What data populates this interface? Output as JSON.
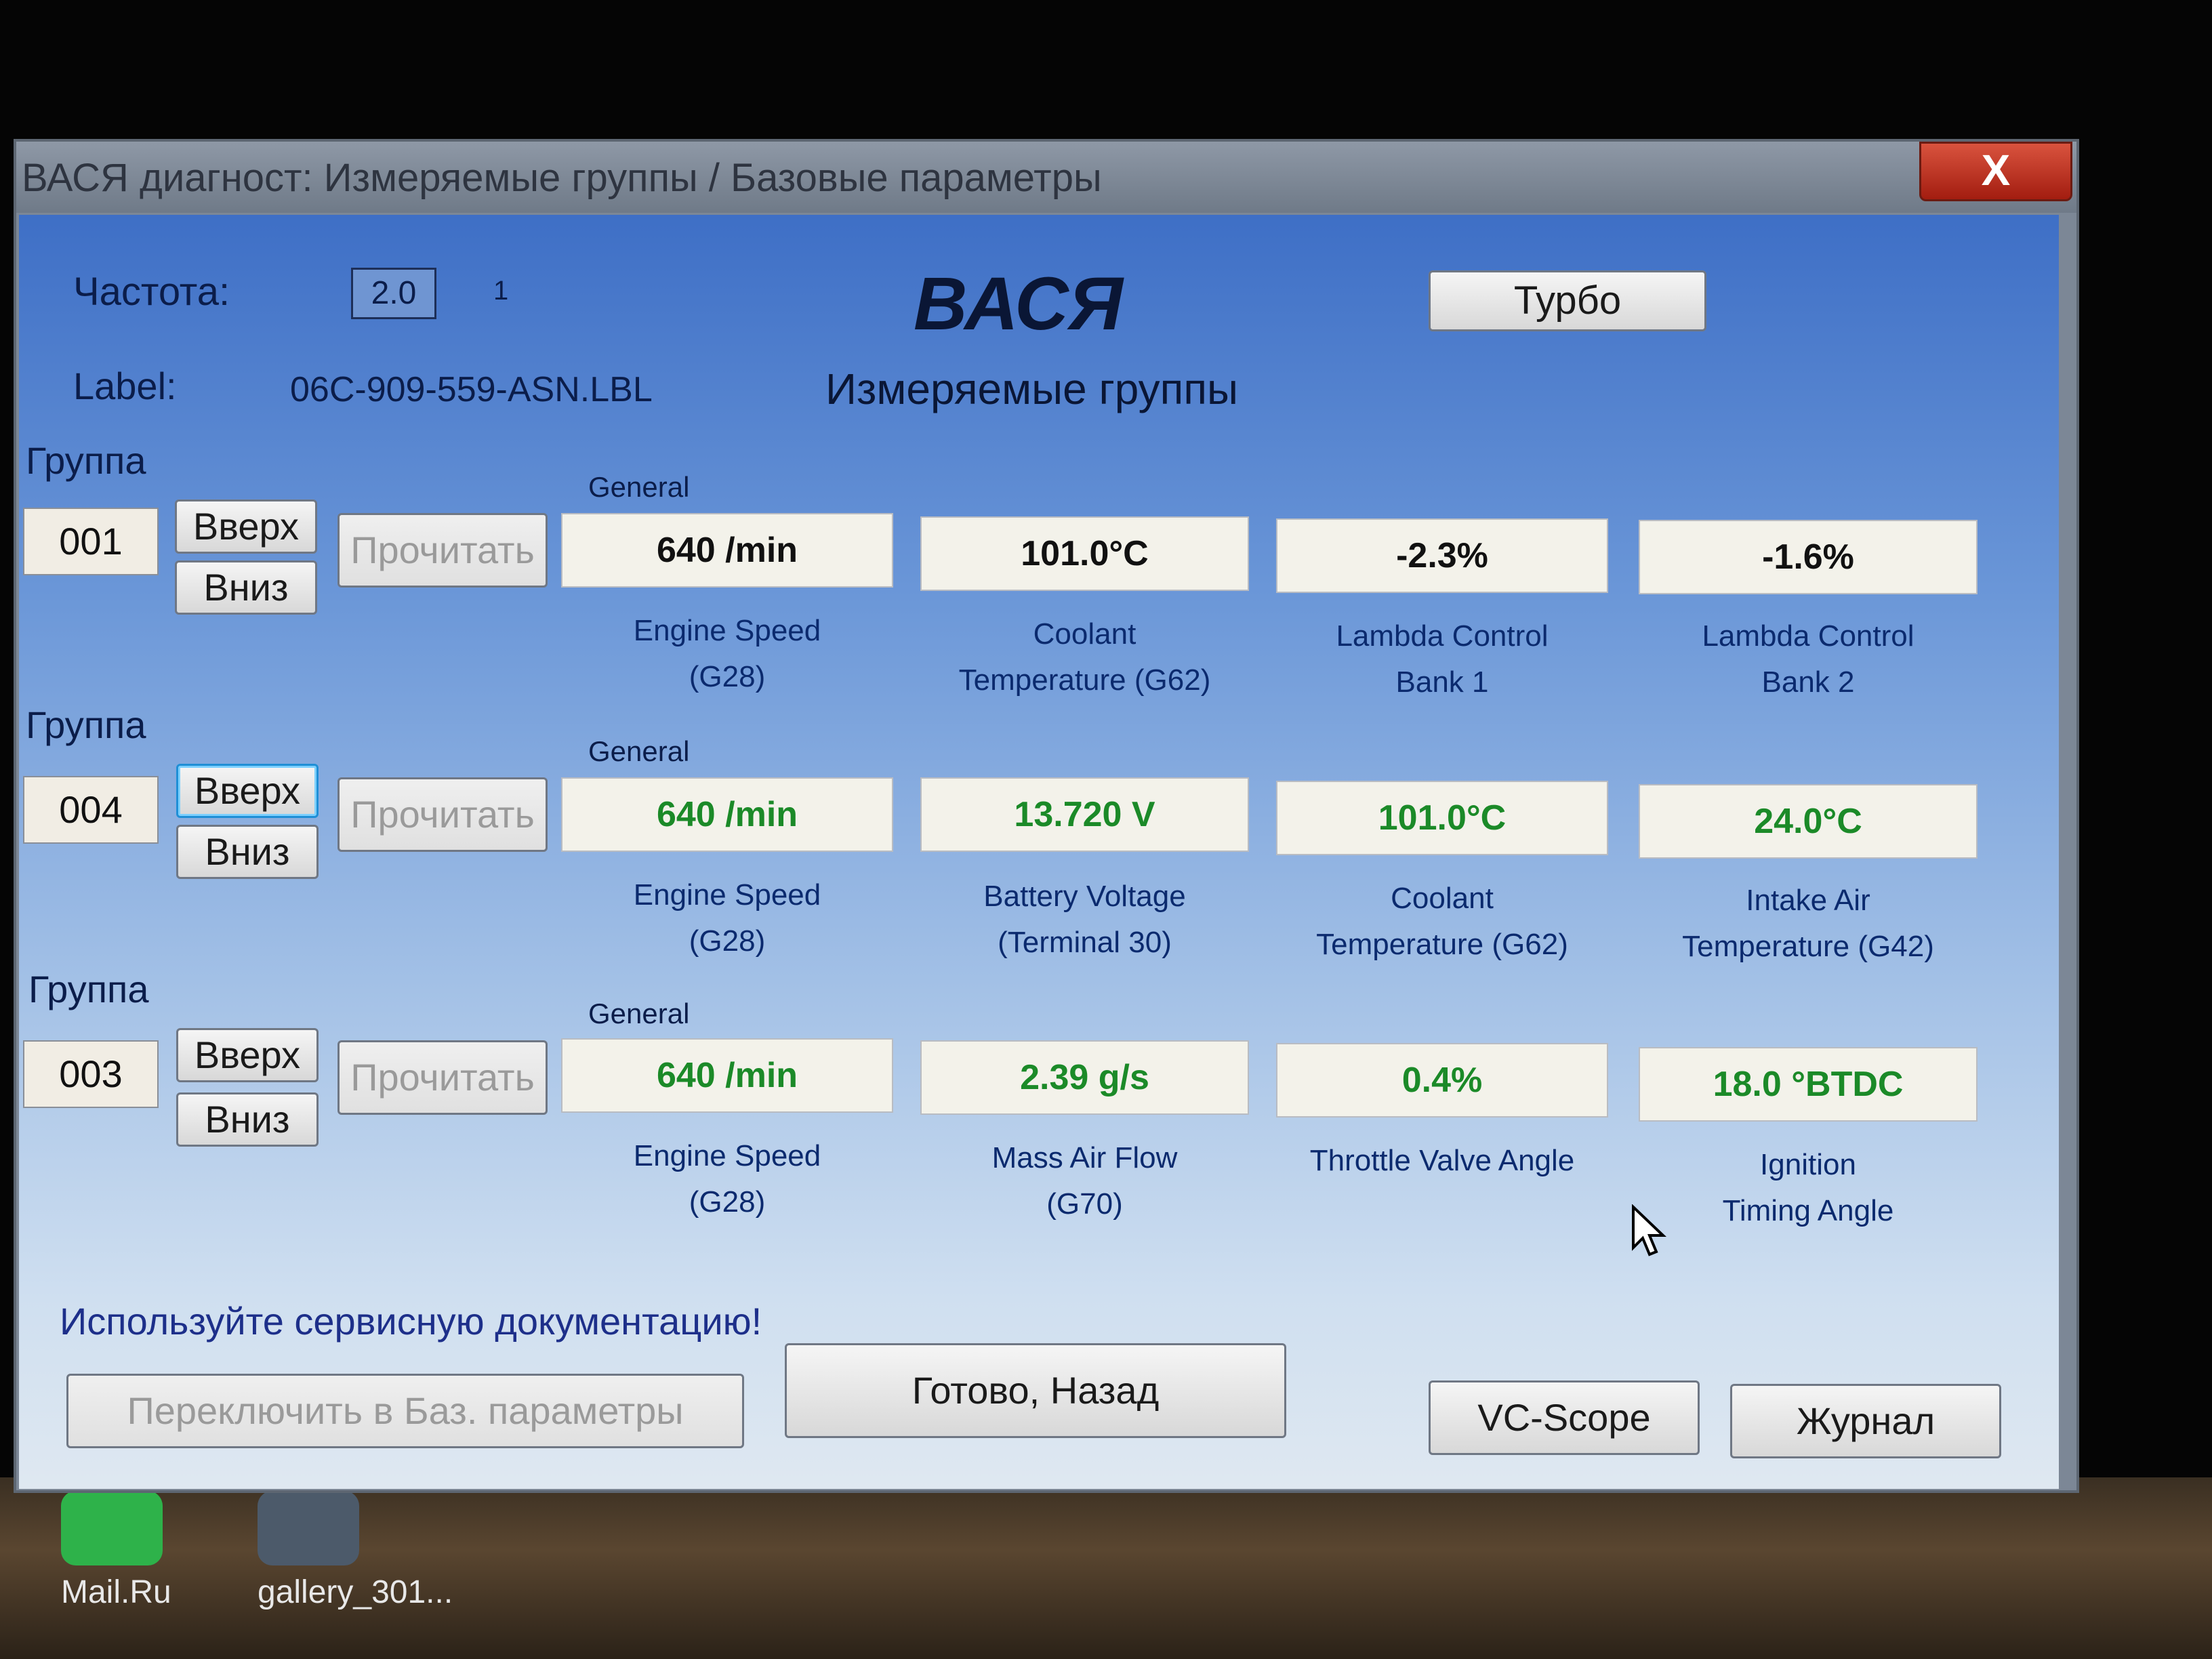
{
  "window": {
    "title": "ВАСЯ диагност: Измеряемые группы / Базовые параметры",
    "close_glyph": "X"
  },
  "header": {
    "frequency_label": "Частота:",
    "frequency_value": "2.0",
    "frequency_unit": "1",
    "label_key": "Label:",
    "label_value": "06C-909-559-ASN.LBL",
    "app_name": "ВАСЯ",
    "subtitle": "Измеряемые группы",
    "turbo_label": "Турбо"
  },
  "groups": [
    {
      "title": "Группа",
      "number": "001",
      "up_label": "Вверх",
      "down_label": "Вниз",
      "read_label": "Прочитать",
      "general_label": "General",
      "values": [
        {
          "value": "640 /min",
          "desc1": "Engine Speed",
          "desc2": "(G28)"
        },
        {
          "value": "101.0°C",
          "desc1": "Coolant",
          "desc2": "Temperature (G62)"
        },
        {
          "value": "-2.3%",
          "desc1": "Lambda Control",
          "desc2": "Bank 1"
        },
        {
          "value": "-1.6%",
          "desc1": "Lambda Control",
          "desc2": "Bank 2"
        }
      ]
    },
    {
      "title": "Группа",
      "number": "004",
      "up_label": "Вверх",
      "down_label": "Вниз",
      "read_label": "Прочитать",
      "general_label": "General",
      "values": [
        {
          "value": "640 /min",
          "desc1": "Engine Speed",
          "desc2": "(G28)"
        },
        {
          "value": "13.720 V",
          "desc1": "Battery Voltage",
          "desc2": "(Terminal 30)"
        },
        {
          "value": "101.0°C",
          "desc1": "Coolant",
          "desc2": "Temperature (G62)"
        },
        {
          "value": "24.0°C",
          "desc1": "Intake Air",
          "desc2": "Temperature (G42)"
        }
      ]
    },
    {
      "title": "Группа",
      "number": "003",
      "up_label": "Вверх",
      "down_label": "Вниз",
      "read_label": "Прочитать",
      "general_label": "General",
      "values": [
        {
          "value": "640 /min",
          "desc1": "Engine Speed",
          "desc2": "(G28)"
        },
        {
          "value": "2.39 g/s",
          "desc1": "Mass Air Flow",
          "desc2": "(G70)"
        },
        {
          "value": "0.4%",
          "desc1": "Throttle Valve Angle",
          "desc2": ""
        },
        {
          "value": "18.0 °BTDC",
          "desc1": "Ignition",
          "desc2": "Timing Angle"
        }
      ]
    }
  ],
  "footer": {
    "hint": "Используйте сервисную документацию!",
    "switch_label": "Переключить в Баз. параметры",
    "done_label": "Готово, Назад",
    "vcscope_label": "VC-Scope",
    "journal_label": "Журнал"
  },
  "desktop": {
    "icon1_label": "Mail.Ru",
    "icon2_label": "gallery_301..."
  },
  "colors": {
    "value_green": "#1b8a28",
    "client_top": "#3e6fc6",
    "client_bottom": "#dfe8f1",
    "close_red": "#c0392b"
  }
}
